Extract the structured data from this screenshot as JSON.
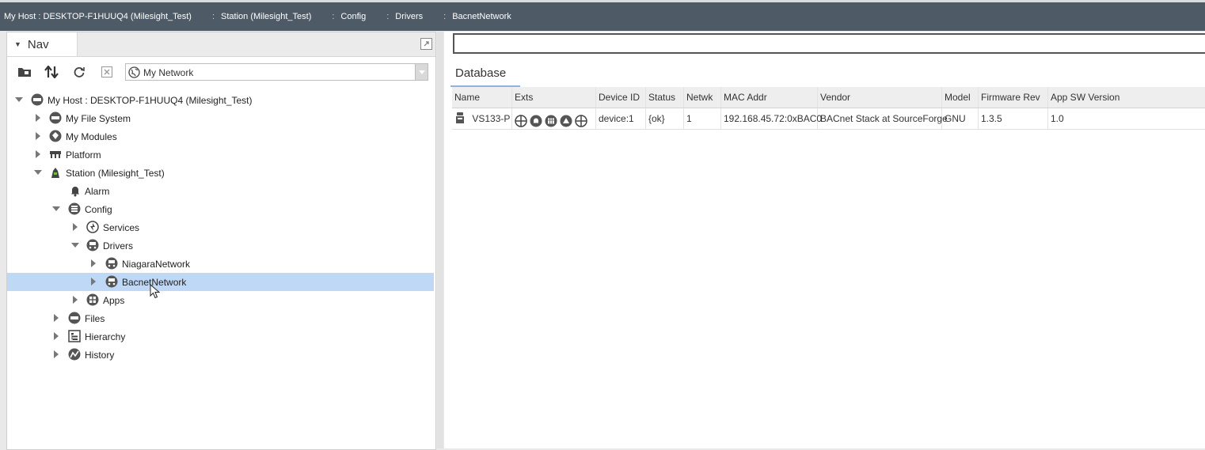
{
  "breadcrumb": [
    "My Host : DESKTOP-F1HUUQ4 (Milesight_Test)",
    "Station (Milesight_Test)",
    "Config",
    "Drivers",
    "BacnetNetwork"
  ],
  "nav": {
    "tab_label": "Nav",
    "network_select": "My Network",
    "tree": [
      {
        "label": "My Host : DESKTOP-F1HUUQ4 (Milesight_Test)",
        "icon": "host-icon"
      },
      {
        "label": "My File System",
        "icon": "file-system-icon"
      },
      {
        "label": "My Modules",
        "icon": "modules-icon"
      },
      {
        "label": "Platform",
        "icon": "platform-icon"
      },
      {
        "label": "Station (Milesight_Test)",
        "icon": "station-icon"
      },
      {
        "label": "Alarm",
        "icon": "bell-icon"
      },
      {
        "label": "Config",
        "icon": "config-icon"
      },
      {
        "label": "Services",
        "icon": "services-icon"
      },
      {
        "label": "Drivers",
        "icon": "drivers-icon"
      },
      {
        "label": "NiagaraNetwork",
        "icon": "network-icon"
      },
      {
        "label": "BacnetNetwork",
        "icon": "network-icon"
      },
      {
        "label": "Apps",
        "icon": "apps-icon"
      },
      {
        "label": "Files",
        "icon": "files-icon"
      },
      {
        "label": "Hierarchy",
        "icon": "hierarchy-icon"
      },
      {
        "label": "History",
        "icon": "history-icon"
      }
    ]
  },
  "database": {
    "tab_label": "Database",
    "columns": [
      "Name",
      "Exts",
      "Device ID",
      "Status",
      "Netwk",
      "MAC Addr",
      "Vendor",
      "Model",
      "Firmware Rev",
      "App SW Version"
    ],
    "rows": [
      {
        "name": "VS133-P",
        "device_id": "device:1",
        "status": "{ok}",
        "netwk": "1",
        "mac": "192.168.45.72:0xBAC0",
        "vendor": "BACnet Stack at SourceForge",
        "model": "GNU",
        "firmware": "1.3.5",
        "app_sw": "1.0"
      }
    ]
  },
  "colors": {
    "header_bg": "#4e5a66",
    "selection": "#bfd8f6"
  }
}
